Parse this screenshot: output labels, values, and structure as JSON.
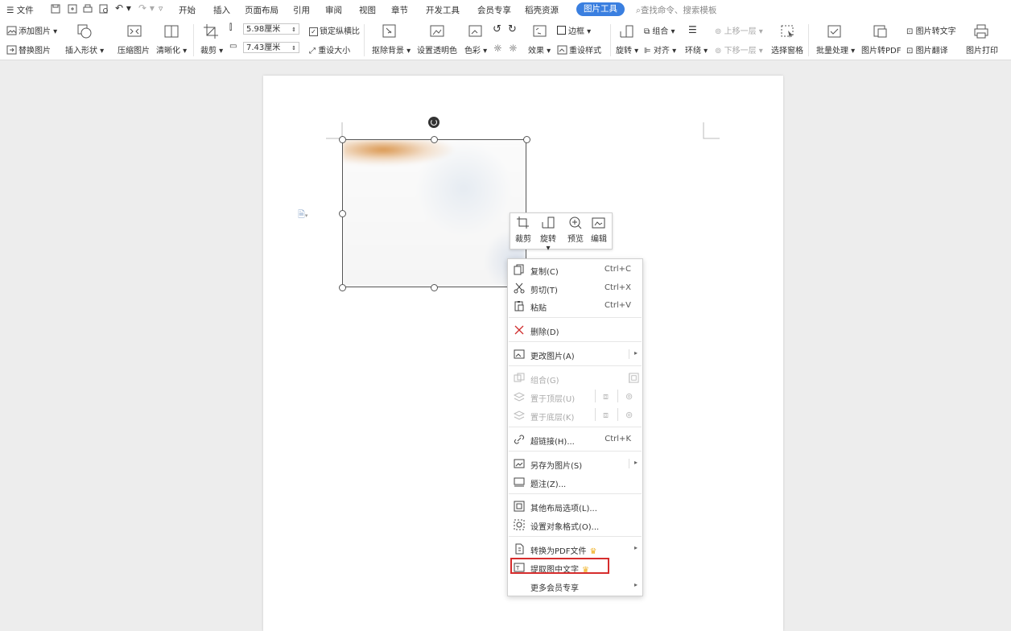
{
  "menubar": {
    "file": "文件",
    "tabs": [
      "开始",
      "插入",
      "页面布局",
      "引用",
      "审阅",
      "视图",
      "章节",
      "开发工具",
      "会员专享",
      "稻壳资源"
    ],
    "active_tab": "图片工具",
    "search": "查找命令、搜索模板"
  },
  "ribbon": {
    "add_image": "添加图片",
    "replace_image": "替换图片",
    "insert_shape": "插入形状",
    "compress": "压缩图片",
    "clarity": "清晰化",
    "crop": "裁剪",
    "width": "5.98厘米",
    "height": "7.43厘米",
    "lock_ratio": "锁定纵横比",
    "reset_size": "重设大小",
    "remove_bg": "抠除背景",
    "set_transparent": "设置透明色",
    "color": "色彩",
    "effect": "效果",
    "border": "边框",
    "reset_style": "重设样式",
    "rotate": "旋转",
    "group": "组合",
    "align": "对齐",
    "wrap": "环绕",
    "bring_forward": "上移一层",
    "send_backward": "下移一层",
    "select_pane": "选择窗格",
    "batch": "批量处理",
    "to_pdf": "图片转PDF",
    "to_text": "图片转文字",
    "translate": "图片翻译",
    "print": "图片打印"
  },
  "float_toolbar": [
    "裁剪",
    "旋转",
    "预览",
    "编辑"
  ],
  "context_menu": [
    {
      "label": "复制(C)",
      "shortcut": "Ctrl+C"
    },
    {
      "label": "剪切(T)",
      "shortcut": "Ctrl+X"
    },
    {
      "label": "粘贴",
      "shortcut": "Ctrl+V"
    },
    {
      "label": "删除(D)"
    },
    {
      "label": "更改图片(A)"
    },
    {
      "label": "组合(G)"
    },
    {
      "label": "置于顶层(U)"
    },
    {
      "label": "置于底层(K)"
    },
    {
      "label": "超链接(H)...",
      "shortcut": "Ctrl+K"
    },
    {
      "label": "另存为图片(S)"
    },
    {
      "label": "题注(Z)..."
    },
    {
      "label": "其他布局选项(L)..."
    },
    {
      "label": "设置对象格式(O)..."
    },
    {
      "label": "转换为PDF文件"
    },
    {
      "label": "提取图中文字"
    },
    {
      "label": "更多会员专享"
    }
  ],
  "colors": {
    "accent": "#3a7fe0",
    "highlight": "#d62d2d",
    "crown": "#f0b020"
  }
}
